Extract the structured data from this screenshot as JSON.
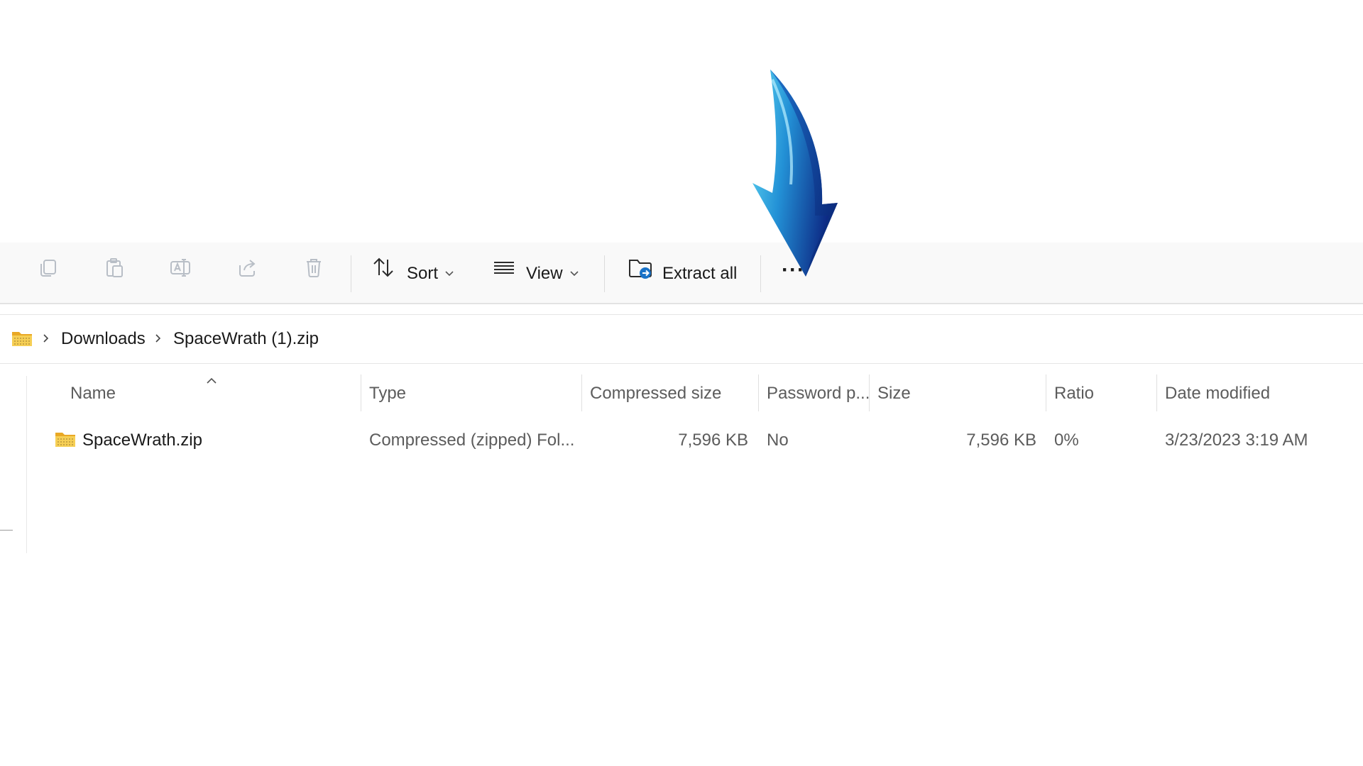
{
  "toolbar": {
    "copy_icon": "copy-icon",
    "paste_icon": "paste-icon",
    "rename_icon": "rename-icon",
    "share_icon": "share-icon",
    "delete_icon": "trash-icon",
    "sort_label": "Sort",
    "view_label": "View",
    "extract_label": "Extract all",
    "more_label": "···"
  },
  "breadcrumb": {
    "items": [
      "Downloads",
      "SpaceWrath (1).zip"
    ]
  },
  "columns": [
    "Name",
    "Type",
    "Compressed size",
    "Password p...",
    "Size",
    "Ratio",
    "Date modified"
  ],
  "rows": [
    {
      "name": "SpaceWrath.zip",
      "type": "Compressed (zipped) Fol...",
      "compressed_size": "7,596 KB",
      "password": "No",
      "size": "7,596 KB",
      "ratio": "0%",
      "date_modified": "3/23/2023 3:19 AM"
    }
  ],
  "colors": {
    "arrow_light": "#3fc6ea",
    "arrow_dark": "#0e2f8c",
    "folder_yellow": "#f4c542",
    "accent_blue": "#1a73c8"
  }
}
